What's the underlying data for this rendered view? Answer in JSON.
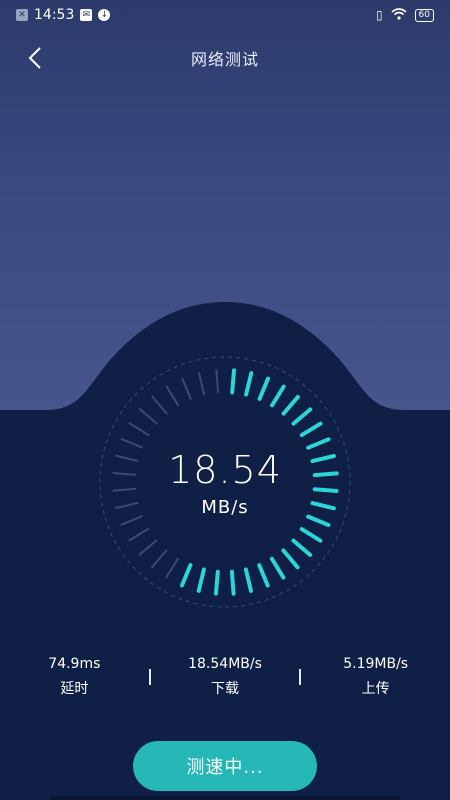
{
  "status_bar": {
    "time": "14:53",
    "battery": "60"
  },
  "header": {
    "title": "网络测试"
  },
  "gauge": {
    "value": "18.54",
    "unit": "MB/s",
    "active_color": "#2ad6d6",
    "inactive_color": "#3b4a74",
    "total_ticks": 40,
    "active_ticks": 23
  },
  "stats": [
    {
      "value": "74.9ms",
      "label": "延时"
    },
    {
      "value": "18.54MB/s",
      "label": "下载"
    },
    {
      "value": "5.19MB/s",
      "label": "上传"
    }
  ],
  "button": {
    "label": "测速中..."
  },
  "colors": {
    "accent": "#26b7b7",
    "background_dark": "#0f1f45"
  }
}
